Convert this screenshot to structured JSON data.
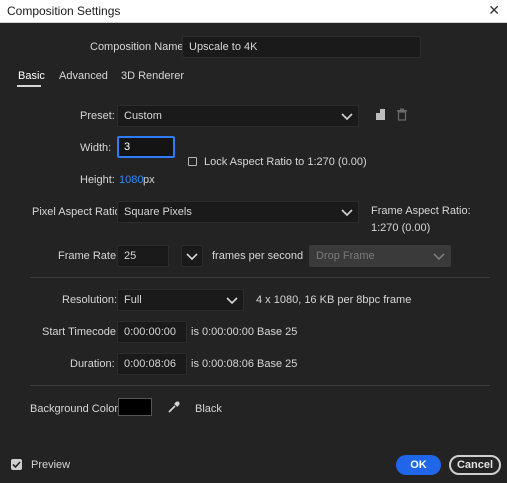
{
  "window": {
    "title": "Composition Settings",
    "close_glyph": "✕"
  },
  "composition_name": {
    "label": "Composition Name:",
    "value": "Upscale to 4K"
  },
  "tabs": [
    {
      "label": "Basic",
      "active": true
    },
    {
      "label": "Advanced",
      "active": false
    },
    {
      "label": "3D Renderer",
      "active": false
    }
  ],
  "preset": {
    "label": "Preset:",
    "value": "Custom",
    "icons": [
      "save-preset-icon",
      "trash-icon"
    ]
  },
  "width": {
    "label": "Width:",
    "value": "3"
  },
  "lock_aspect": {
    "label": "Lock Aspect Ratio to 1:270 (0.00)",
    "checked": false
  },
  "height": {
    "label": "Height:",
    "value": "1080",
    "unit": "px"
  },
  "pixel_aspect": {
    "label": "Pixel Aspect Ratio:",
    "value": "Square Pixels",
    "frame_aspect_label": "Frame Aspect Ratio:",
    "frame_aspect_value": "1:270 (0.00)"
  },
  "frame_rate": {
    "label": "Frame Rate:",
    "value": "25",
    "unit": "frames per second",
    "drop_frame": "Drop Frame"
  },
  "resolution": {
    "label": "Resolution:",
    "value": "Full",
    "info": "4 x 1080, 16 KB per 8bpc frame"
  },
  "start_timecode": {
    "label": "Start Timecode:",
    "value": "0:00:00:00",
    "info": "is 0:00:00:00  Base 25"
  },
  "duration": {
    "label": "Duration:",
    "value": "0:00:08:06",
    "info": "is 0:00:08:06  Base 25"
  },
  "background": {
    "label": "Background Color:",
    "color": "#000000",
    "name": "Black"
  },
  "footer": {
    "preview_label": "Preview",
    "preview_checked": true,
    "ok_label": "OK",
    "cancel_label": "Cancel"
  },
  "colors": {
    "accent": "#1f66e8",
    "link": "#2f8bf5",
    "background": "#232323"
  }
}
